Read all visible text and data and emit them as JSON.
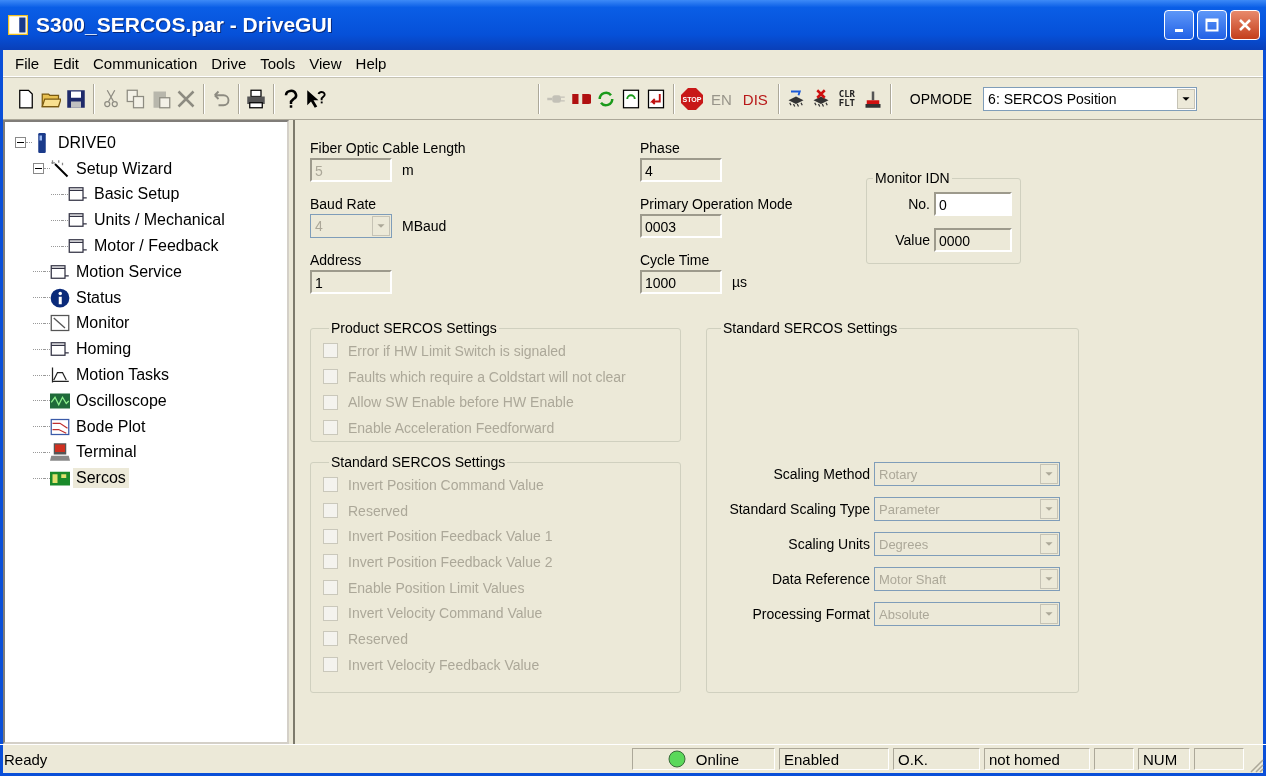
{
  "window": {
    "title": "S300_SERCOS.par - DriveGUI"
  },
  "menu": [
    "File",
    "Edit",
    "Communication",
    "Drive",
    "Tools",
    "View",
    "Help"
  ],
  "toolbar": {
    "groups": [
      [
        {
          "kind": "icon",
          "disabled": false
        },
        {
          "kind": "icon",
          "disabled": false
        },
        {
          "kind": "icon",
          "disabled": false
        }
      ],
      [
        {
          "kind": "icon",
          "disabled": true
        },
        {
          "kind": "icon",
          "disabled": true
        },
        {
          "kind": "icon",
          "disabled": true
        },
        {
          "kind": "icon",
          "disabled": true
        }
      ],
      [
        {
          "kind": "icon",
          "disabled": true
        }
      ],
      [
        {
          "kind": "icon",
          "disabled": false
        }
      ],
      [
        {
          "kind": "icon",
          "disabled": false
        },
        {
          "kind": "icon",
          "disabled": false
        }
      ],
      [
        {
          "kind": "icon",
          "disabled": true
        },
        {
          "kind": "icon",
          "disabled": false
        },
        {
          "kind": "icon",
          "disabled": false
        },
        {
          "kind": "icon",
          "disabled": false
        },
        {
          "kind": "icon",
          "disabled": false
        }
      ],
      [
        {
          "kind": "stop",
          "label": "STOP",
          "disabled": false
        },
        {
          "kind": "text",
          "label": "EN",
          "disabled": true
        },
        {
          "kind": "text",
          "label": "DIS",
          "disabled": false
        }
      ],
      [
        {
          "kind": "icon",
          "disabled": false
        },
        {
          "kind": "icon",
          "disabled": false
        },
        {
          "kind": "stack",
          "label": "CLR FLT",
          "disabled": false
        },
        {
          "kind": "icon",
          "disabled": false
        }
      ]
    ],
    "opmode": {
      "label": "OPMODE",
      "value": "6: SERCOS Position"
    }
  },
  "tree": [
    {
      "label": "DRIVE0",
      "expanded": true,
      "selected": false,
      "children": [
        {
          "label": "Setup Wizard",
          "expanded": true,
          "selected": false,
          "children": [
            {
              "label": "Basic Setup",
              "selected": false
            },
            {
              "label": "Units / Mechanical",
              "selected": false
            },
            {
              "label": "Motor / Feedback",
              "selected": false
            }
          ]
        },
        {
          "label": "Motion Service",
          "selected": false
        },
        {
          "label": "Status",
          "selected": false
        },
        {
          "label": "Monitor",
          "selected": false
        },
        {
          "label": "Homing",
          "selected": false
        },
        {
          "label": "Motion Tasks",
          "selected": false
        },
        {
          "label": "Oscilloscope",
          "selected": false
        },
        {
          "label": "Bode Plot",
          "selected": false
        },
        {
          "label": "Terminal",
          "selected": false
        },
        {
          "label": "Sercos",
          "selected": true
        }
      ]
    }
  ],
  "settings": {
    "left": [
      {
        "label": "Fiber Optic Cable Length",
        "kind": "text",
        "value": "5",
        "unit": "m",
        "disabled": true
      },
      {
        "label": "Baud Rate",
        "kind": "select",
        "value": "4",
        "unit": "MBaud",
        "disabled": true
      },
      {
        "label": "Address",
        "kind": "text",
        "value": "1",
        "disabled": false
      }
    ],
    "middle": [
      {
        "label": "Phase",
        "kind": "text",
        "value": "4",
        "disabled": false
      },
      {
        "label": "Primary Operation Mode",
        "kind": "text",
        "value": "0003",
        "disabled": false
      },
      {
        "label": "Cycle Time",
        "kind": "text",
        "value": "1000",
        "unit": "µs",
        "disabled": false
      }
    ]
  },
  "monitor_idn": {
    "title": "Monitor IDN",
    "fields": [
      {
        "label": "No.",
        "value": "0",
        "read_only": false
      },
      {
        "label": "Value",
        "value": "0000",
        "read_only": true
      }
    ]
  },
  "product_sercos_settings": {
    "title": "Product SERCOS Settings",
    "options": [
      {
        "label": "Error if HW Limit Switch is signaled",
        "checked": false,
        "disabled": true
      },
      {
        "label": "Faults which require a Coldstart will not clear",
        "checked": false,
        "disabled": true
      },
      {
        "label": "Allow SW Enable before HW Enable",
        "checked": false,
        "disabled": true
      },
      {
        "label": "Enable Acceleration Feedforward",
        "checked": false,
        "disabled": true
      }
    ]
  },
  "standard_sercos_bits": {
    "title": "Standard SERCOS Settings",
    "options": [
      {
        "label": "Invert Position Command Value",
        "checked": false,
        "disabled": true
      },
      {
        "label": "Reserved",
        "checked": false,
        "disabled": true
      },
      {
        "label": "Invert Position Feedback Value 1",
        "checked": false,
        "disabled": true
      },
      {
        "label": "Invert Position Feedback Value 2",
        "checked": false,
        "disabled": true
      },
      {
        "label": "Enable Position Limit Values",
        "checked": false,
        "disabled": true
      },
      {
        "label": "Invert Velocity Command Value",
        "checked": false,
        "disabled": true
      },
      {
        "label": "Reserved",
        "checked": false,
        "disabled": true
      },
      {
        "label": "Invert Velocity Feedback Value",
        "checked": false,
        "disabled": true
      }
    ]
  },
  "standard_sercos_scaling": {
    "title": "Standard SERCOS Settings",
    "fields": [
      {
        "label": "Scaling Method",
        "value": "Rotary",
        "disabled": true
      },
      {
        "label": "Standard Scaling Type",
        "value": "Parameter",
        "disabled": true
      },
      {
        "label": "Scaling Units",
        "value": "Degrees",
        "disabled": true
      },
      {
        "label": "Data Reference",
        "value": "Motor Shaft",
        "disabled": true
      },
      {
        "label": "Processing Format",
        "value": "Absolute",
        "disabled": true
      }
    ]
  },
  "status_bar": {
    "message": "Ready",
    "panels": [
      {
        "kind": "led",
        "text": "Online",
        "on": true
      },
      {
        "kind": "text",
        "text": "Enabled"
      },
      {
        "kind": "text",
        "text": "O.K."
      },
      {
        "kind": "text",
        "text": "not homed"
      },
      {
        "kind": "blank"
      },
      {
        "kind": "text",
        "text": "NUM"
      },
      {
        "kind": "blank"
      }
    ]
  }
}
